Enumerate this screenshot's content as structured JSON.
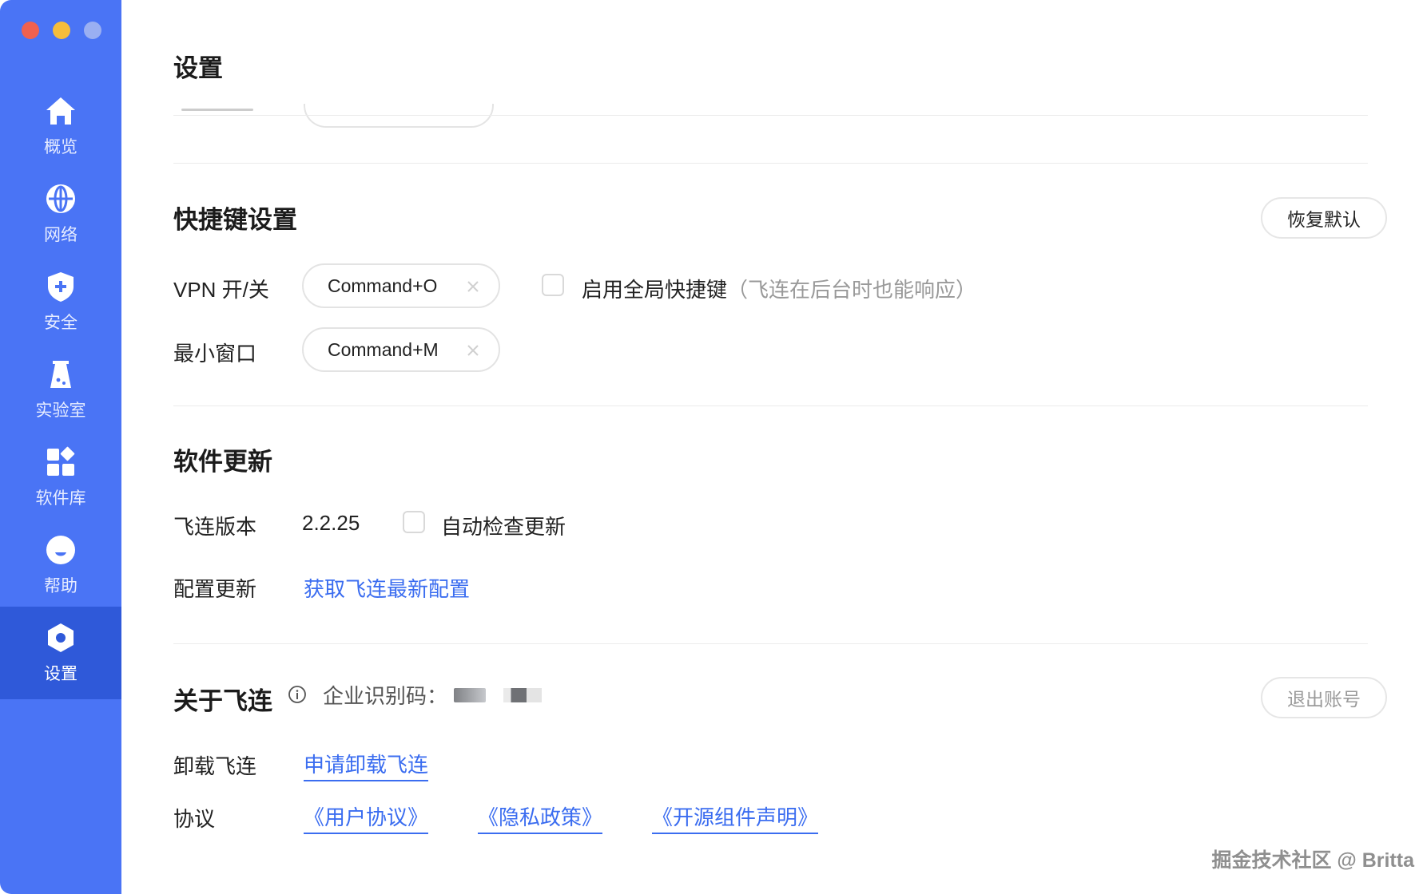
{
  "sidebar": {
    "items": [
      {
        "label": "概览",
        "icon": "home-icon"
      },
      {
        "label": "网络",
        "icon": "globe-icon"
      },
      {
        "label": "安全",
        "icon": "shield-icon"
      },
      {
        "label": "实验室",
        "icon": "flask-icon"
      },
      {
        "label": "软件库",
        "icon": "apps-grid-icon"
      },
      {
        "label": "帮助",
        "icon": "help-face-icon"
      },
      {
        "label": "设置",
        "icon": "gear-hex-icon",
        "active": true
      }
    ],
    "colors": {
      "background": "#4a74f5",
      "active": "#2f59d9"
    }
  },
  "page": {
    "title": "设置"
  },
  "shortcuts": {
    "title": "快捷键设置",
    "reset_label": "恢复默认",
    "vpn_label": "VPN 开/关",
    "vpn_value": "Command+O",
    "minimize_label": "最小窗口",
    "minimize_value": "Command+M",
    "global_label": "启用全局快捷键",
    "global_hint": "（飞连在后台时也能响应）"
  },
  "update": {
    "title": "软件更新",
    "version_label": "飞连版本",
    "version_value": "2.2.25",
    "auto_check_label": "自动检查更新",
    "config_label": "配置更新",
    "config_link": "获取飞连最新配置"
  },
  "about": {
    "title": "关于飞连",
    "enterprise_label": "企业识别码：",
    "logout_label": "退出账号",
    "uninstall_label": "卸载飞连",
    "uninstall_link": "申请卸载飞连",
    "agreement_label": "协议",
    "agreements": [
      "《用户协议》",
      "《隐私政策》",
      "《开源组件声明》"
    ]
  },
  "watermark": "掘金技术社区 @ Britta",
  "accent_color": "#3b6df0"
}
